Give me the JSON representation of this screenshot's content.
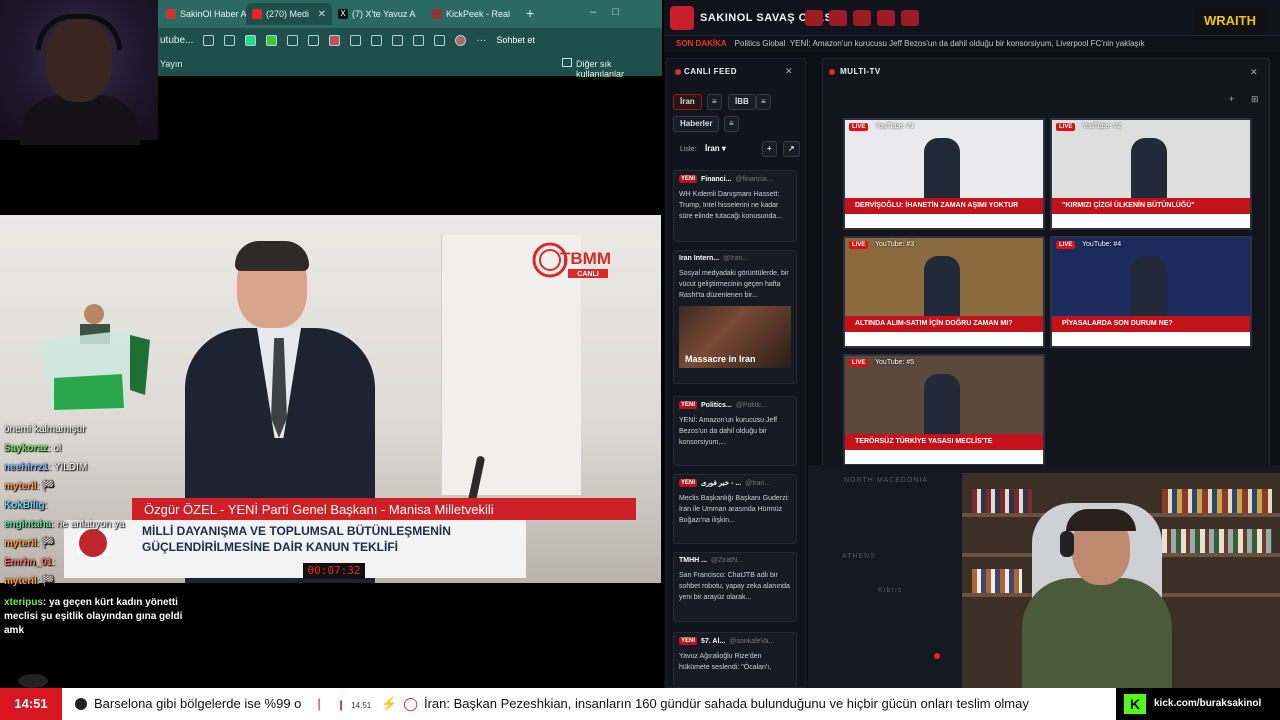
{
  "browser": {
    "tabs": [
      {
        "label": "SakinOl Haber A",
        "color": "#c33"
      },
      {
        "label": "(270) Medi",
        "color": "#e22"
      },
      {
        "label": "(7) X'te Yavuz A",
        "color": "#111"
      },
      {
        "label": "KickPeek - Real",
        "color": "#933"
      }
    ],
    "url_fragment": "utube...",
    "chat_button": "Sohbet et",
    "bookmarks": {
      "item": "Yayın",
      "other": "Diğer sık kullanılanlar"
    }
  },
  "video": {
    "channel_logo": "TBMM",
    "channel_logo_sub": "CANLI",
    "name_strap": "Özgür ÖZEL - YENİ Parti Genel Başkanı - Manisa Milletvekili",
    "title_line1": "MİLLİ DAYANIŞMA VE TOPLUMSAL BÜTÜNLEŞMENİN",
    "title_line2": "GÜÇLENDİRİLMESİNE DAİR KANUN TEKLİFİ",
    "timer": "00:07:32"
  },
  "chat": {
    "lines": [
      {
        "user": "",
        "text": "önemi kalmamıştır",
        "color": "#fff"
      },
      {
        "user": "Saykoraz",
        "text": ": ol",
        "color": "#7be35a"
      },
      {
        "user": "neehirrz1",
        "text": ": YILDIM",
        "color": "#7fb8ff"
      },
      {
        "user": "myteril",
        "text": ": 🏁",
        "color": "#ff9a4a"
      },
      {
        "user": "KokBilig",
        "text": ": ",
        "color": "#6ad1ff"
      },
      {
        "user": "engintaha",
        "text": ": ne anlatıyon ya",
        "color": "#58e0a0"
      },
      {
        "user": "myteril",
        "text": ": 🏁",
        "color": "#ff9a4a"
      },
      {
        "user": "Emrhn_01",
        "text": ": ",
        "color": "#ff6a6a"
      },
      {
        "user": "myteril",
        "text": ": 🏁",
        "color": "#ff9a4a"
      }
    ],
    "last_user": "xteripus",
    "last_text": ": ya geçen kürt kadın yönetti meclisi şu eşitlik olayından gına geldi amk"
  },
  "dashboard": {
    "title": "SAKINOL SAVAŞ ODASI",
    "brand": "WRAITH",
    "news_tag": "SON DAKİKA",
    "news_source": "Politics Global",
    "news_text": "YENİ: Amazon'un kurucusu Jeff Bezos'un da dahil olduğu bir konsorsiyum, Liverpool FC'nin yaklaşık"
  },
  "feed": {
    "title": "CANLI FEED",
    "chips": [
      "İran",
      "İBB",
      "Haberler"
    ],
    "list_label": "Liste:",
    "list_value": "İran",
    "cards": [
      {
        "badge": "YENİ",
        "name": "Financi...",
        "src": "@financia...",
        "body": "WH Kıdemli Danışmanı Hassett: Trump, Intel hisselerini ne kadar süre elinde tutacağı konusunda..."
      },
      {
        "badge": "",
        "name": "Iran Intern...",
        "src": "@Iran...",
        "body": "Sosyal medyadaki görüntülerde, bir vücut geliştirmecinin geçen hafta Rasht'ta düzenlenen bir...",
        "image_caption": "Massacre in Iran"
      },
      {
        "badge": "YENİ",
        "name": "Politics...",
        "src": "@Politic...",
        "body": "YENİ: Amazon'un kurucusu Jeff Bezos'un da dahil olduğu bir konsorsiyum,..."
      },
      {
        "badge": "YENİ",
        "name": "خبر فوری - ...",
        "src": "@Iran...",
        "body": "Meclis Başkanlığı Başkanı Guderzi: İran ile Umman arasında Hürmüz Boğazı'na ilişkin..."
      },
      {
        "badge": "",
        "name": "ТМНН ...",
        "src": "@ZiratN...",
        "body": "San Francisco: ChatJTB adlı bir sohbet robotu, yapay zeka alanında yeni bir arayüz olarak..."
      },
      {
        "badge": "YENİ",
        "name": "57. Al...",
        "src": "@sonkaleVa...",
        "body": "Yavuz Ağıralioğlu Rize'den hükümete seslendi: \"Öcalan'ı,"
      }
    ]
  },
  "multitv": {
    "title": "MULTI-TV",
    "thumbs": [
      {
        "live": "LIVE",
        "label": "YouTube: #1",
        "caption": "DERVİŞOĞLU: İHANETİN ZAMAN AŞIMI YOKTUR",
        "bg": "#e9e9ee"
      },
      {
        "live": "LIVE",
        "label": "YouTube: #2",
        "caption": "\"KIRMIZI ÇİZGİ ÜLKENİN BÜTÜNLÜĞÜ\"",
        "bg": "#dedede"
      },
      {
        "live": "LIVE",
        "label": "YouTube: #3",
        "caption": "ALTINDA ALIM-SATIM İÇİN DOĞRU ZAMAN MI?",
        "bg": "#8a6a3e"
      },
      {
        "live": "LIVE",
        "label": "YouTube: #4",
        "caption": "PİYASALARDA SON DURUM NE?",
        "bg": "#1a2b5c"
      },
      {
        "live": "LIVE",
        "label": "YouTube: #5",
        "caption": "TERÖRSÜZ TÜRKİYE YASASI MECLİS'TE",
        "bg": "#5b4a3c"
      }
    ]
  },
  "map_labels": [
    "NORTH MACEDONIA",
    "ATHENS",
    "Kıbrıs"
  ],
  "bottom": {
    "time": "14:51",
    "ticker_a": "Barselona gibi bölgelerde ise %99 o",
    "ticker_time": "14:51",
    "ticker_b": "İran: Başkan Pezeshkian, insanların 160 gündür sahada bulunduğunu ve hiçbir gücün onları teslim olmay",
    "kick": "kick.com/buraksakinol",
    "kick_logo": "K"
  }
}
